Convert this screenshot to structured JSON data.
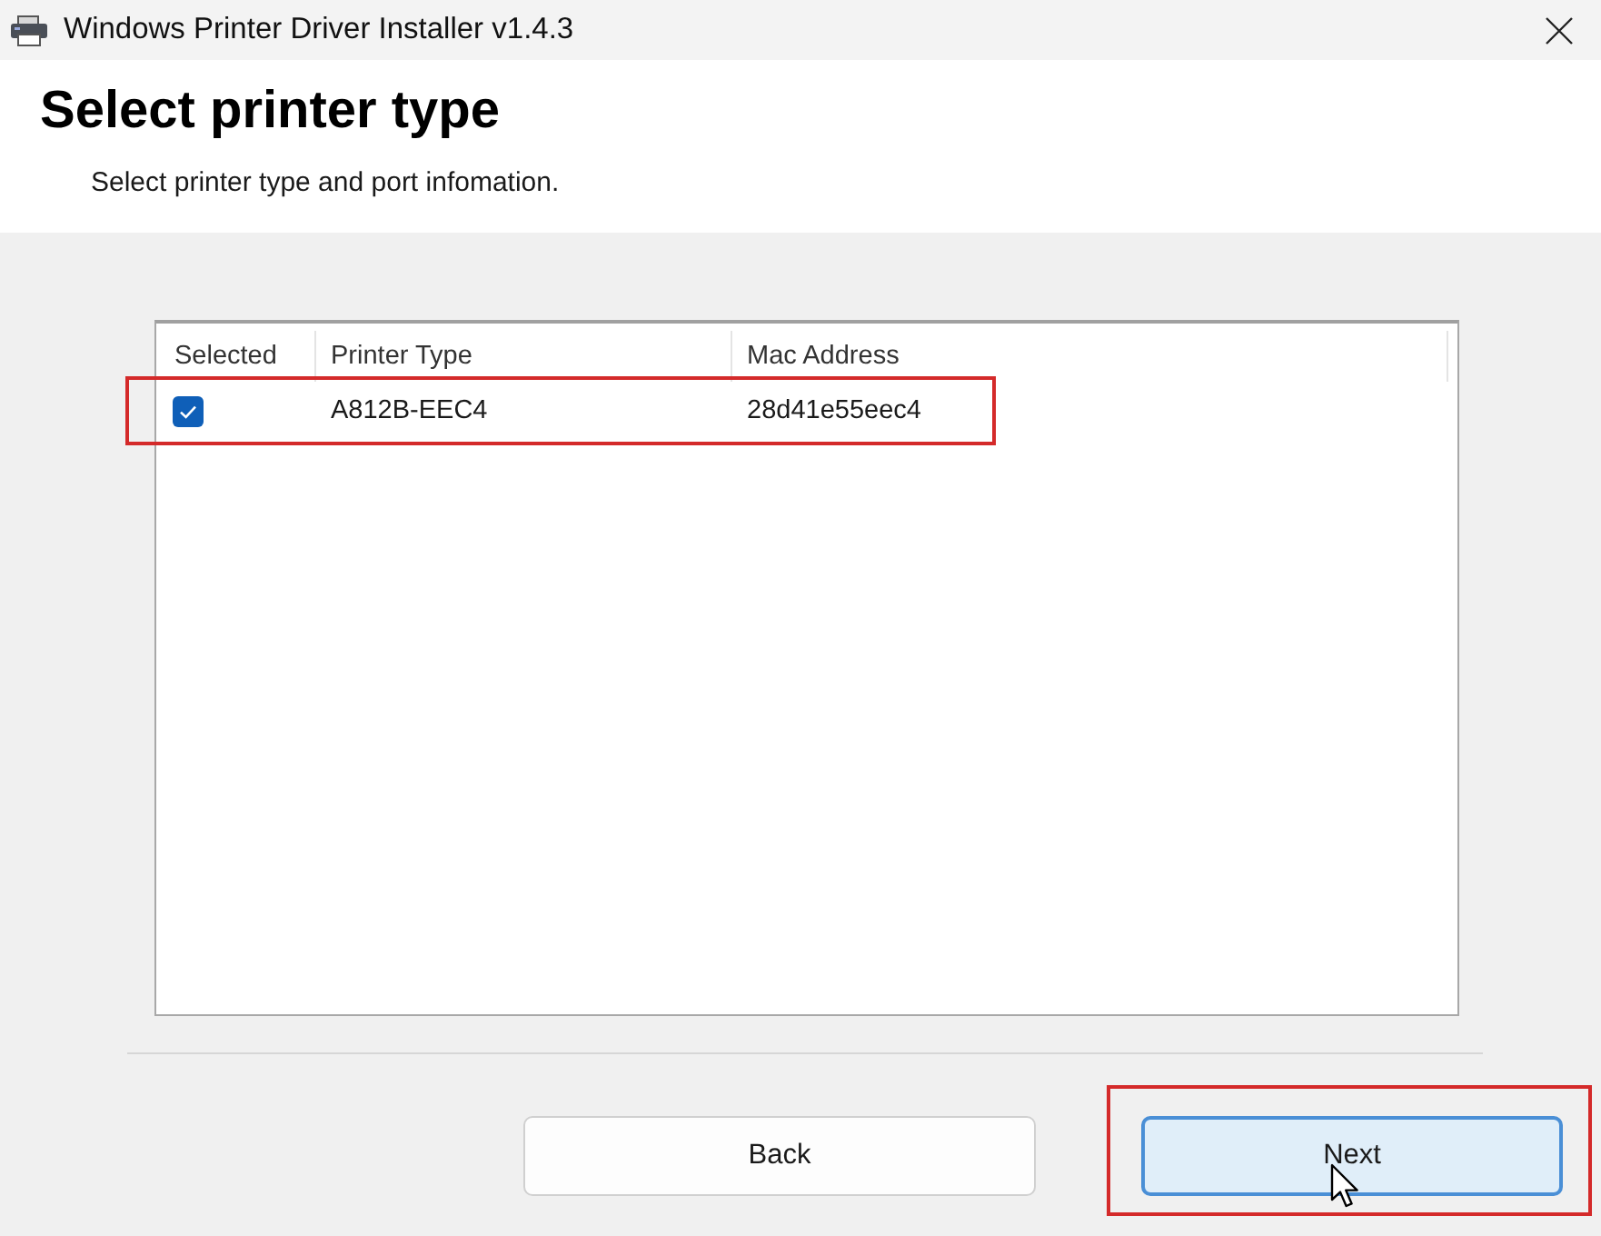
{
  "window": {
    "title": "Windows Printer Driver Installer v1.4.3"
  },
  "header": {
    "title": "Select printer type",
    "subtitle": "Select printer type and port infomation."
  },
  "printer_list": {
    "columns": [
      "Selected",
      "Printer Type",
      "Mac Address"
    ],
    "rows": [
      {
        "checked": true,
        "printer_type": "A812B-EEC4",
        "mac_address": "28d41e55eec4"
      }
    ]
  },
  "buttons": [
    {
      "label": "Back",
      "focused": false
    },
    {
      "label": "Next",
      "focused": true
    }
  ]
}
